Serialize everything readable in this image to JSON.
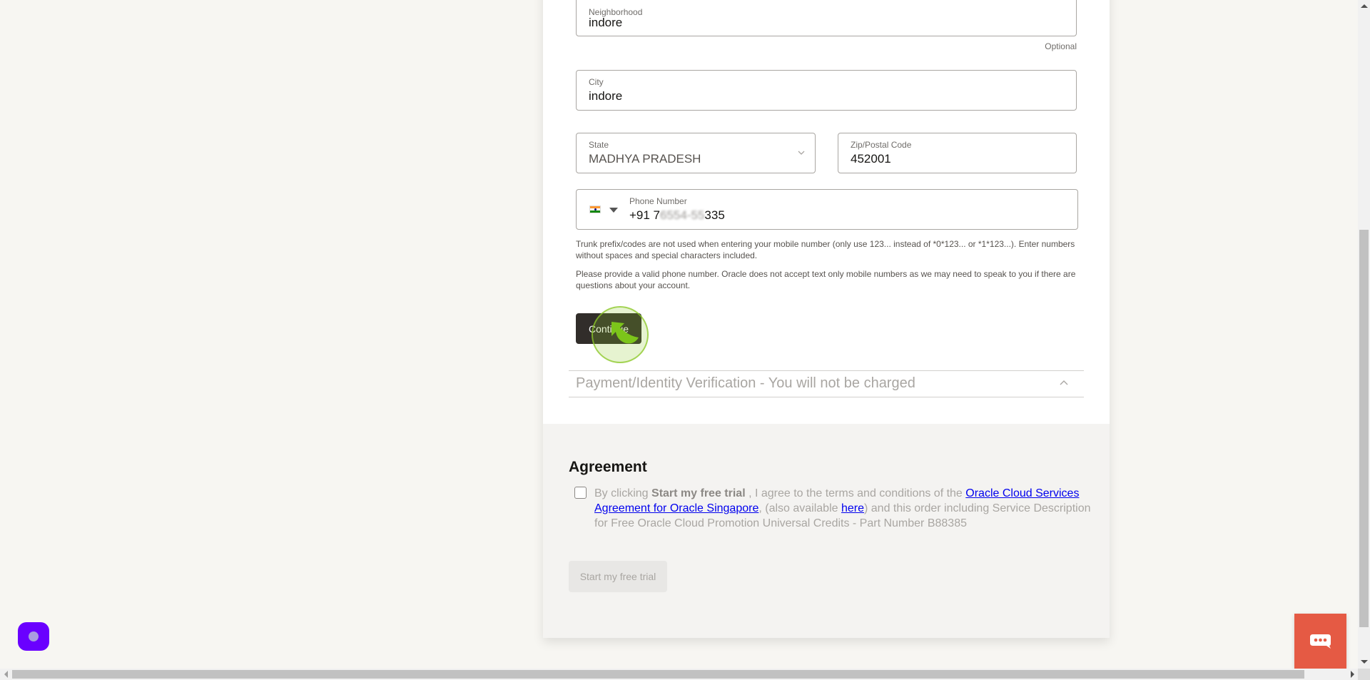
{
  "form": {
    "neighborhood": {
      "label": "Neighborhood",
      "value": "indore",
      "hint": "Optional"
    },
    "city": {
      "label": "City",
      "value": "indore"
    },
    "state": {
      "label": "State",
      "value": "MADHYA PRADESH"
    },
    "zip": {
      "label": "Zip/Postal Code",
      "value": "452001"
    },
    "phone": {
      "label": "Phone Number",
      "country_flag": "india-flag-icon",
      "prefix": "+91 7",
      "masked": "6554-55",
      "suffix": "335"
    },
    "help_text_1": "Trunk prefix/codes are not used when entering your mobile number (only use 123... instead of *0*123... or *1*123...). Enter numbers without spaces and special characters included.",
    "help_text_2": "Please provide a valid phone number. Oracle does not accept text only mobile numbers as we may need to speak to you if there are questions about your account.",
    "continue_label": "Continue"
  },
  "payment_section": {
    "title": "Payment/Identity Verification - You will not be charged",
    "expanded": false
  },
  "agreement": {
    "heading": "Agreement",
    "text_before": "By clicking ",
    "bold_text": "Start my free trial",
    "text_mid": " , I agree to the terms and conditions of the ",
    "link_1": "Oracle Cloud Services Agreement for Oracle Singapore",
    "text_mid2": ", (also available ",
    "link_2": "here",
    "text_after": ") and this order including Service Description for Free Oracle Cloud Promotion Universal Credits - Part Number B88385",
    "checked": false,
    "start_trial_label": "Start my free trial"
  },
  "widgets": {
    "left_widget_icon": "assistant-icon",
    "chat_icon": "chat-bubble-icon"
  },
  "colors": {
    "continue_bg": "#312d2a",
    "chat_bg": "#e55a44",
    "widget_bg": "#6a00ff",
    "link": "#0000ee"
  }
}
